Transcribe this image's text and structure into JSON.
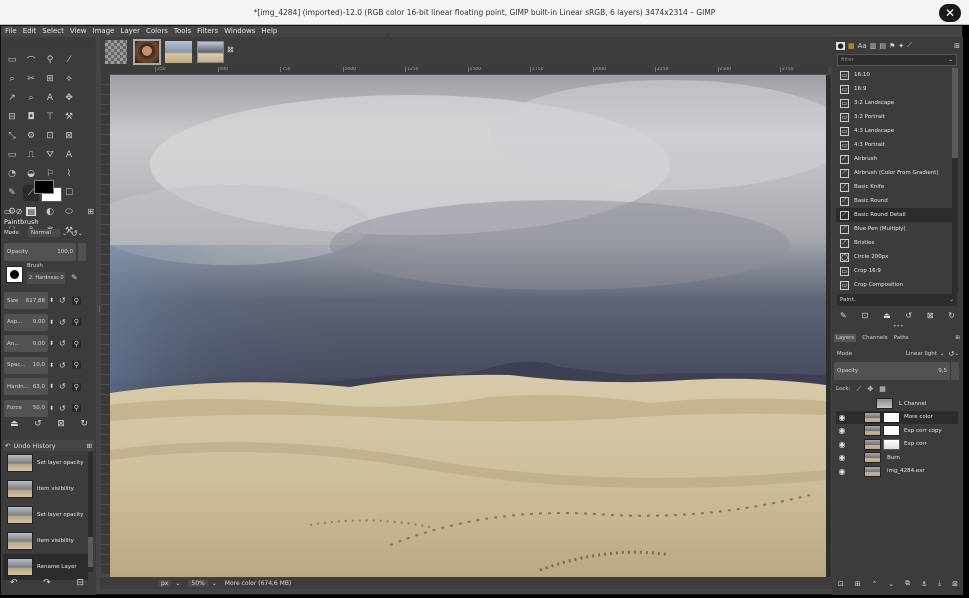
{
  "window": {
    "title": "*[img_4284] (imported)-12.0 (RGB color 16-bit linear floating point, GIMP built-in Linear sRGB, 6 layers) 3474x2314 – GIMP",
    "close_icon": "close-icon"
  },
  "menu": [
    "File",
    "Edit",
    "Select",
    "View",
    "Image",
    "Layer",
    "Colors",
    "Tools",
    "Filters",
    "Windows",
    "Help"
  ],
  "image_tabs": {
    "close_glyph": "⊠"
  },
  "ruler": {
    "ticks": [
      "250",
      "500",
      "750",
      "1000",
      "1250",
      "1500",
      "1750",
      "2000",
      "2250",
      "2500",
      "2750"
    ]
  },
  "toolbox": {
    "tools": [
      "▭",
      "⌒",
      "⚲",
      "⁄",
      "⌕",
      "✂",
      "⊞",
      "⟡",
      "↗",
      "⌕",
      "A",
      "✥",
      "⊟",
      "◘",
      "⊤",
      "⚒",
      "⤡",
      "⚙",
      "⊡",
      "⊠",
      "▭",
      "⎍",
      "⛛",
      "A",
      "◔",
      "◒",
      "⚐",
      "⌇",
      "✎",
      "⟋",
      "◌",
      "☐",
      "⚙",
      "✿",
      "◐",
      "⬭",
      "⛶",
      "⚘",
      "❋",
      "⚒",
      "⚗",
      "⊕",
      "◐"
    ],
    "fg_color": "#000000",
    "bg_color": "#ffffff"
  },
  "tool_options": {
    "title": "Paintbrush",
    "mode_label": "Mode",
    "mode_value": "Normal",
    "opacity_label": "Opacity",
    "opacity_value": "100,0",
    "brush_label": "Brush",
    "brush_name": "2. Hardness 0",
    "size_label": "Size",
    "size_value": "617,88",
    "aspect_label": "Asp...",
    "aspect_value": "0,00",
    "angle_label": "An...",
    "angle_value": "0,00",
    "spacing_label": "Spac...",
    "spacing_value": "10,0",
    "hardness_label": "Hardn...",
    "hardness_value": "63,0",
    "force_label": "Force",
    "force_value": "50,0"
  },
  "undo_history": {
    "title": "Undo History",
    "items": [
      "Set layer opacity",
      "Item visibility",
      "Set layer opacity",
      "Item visibility",
      "Rename Layer"
    ]
  },
  "statusbar": {
    "unit": "px",
    "zoom": "50%",
    "message": "More color (674,6 MB)"
  },
  "brushes": {
    "filter_placeholder": "filter",
    "items": [
      "16:10",
      "16:9",
      "3:2 Landscape",
      "3:2 Portrait",
      "4:3 Landscape",
      "4:3 Portrait",
      "Airbrush",
      "Airbrush (Color From Gradient)",
      "Basic Knife",
      "Basic Round",
      "Basic Round Detail",
      "Blue Pen (Multiply)",
      "Bristles",
      "Circle 200px",
      "Crop 16:9",
      "Crop Composition"
    ],
    "selected_index": 10,
    "category": "Paint."
  },
  "layers": {
    "tabs": [
      "Layers",
      "Channels",
      "Paths"
    ],
    "mode_label": "Mode",
    "mode_value": "Linear light",
    "opacity_label": "Opacity",
    "opacity_value": "9,5",
    "lock_label": "Lock:",
    "items": [
      {
        "name": "L Channel",
        "visible": false
      },
      {
        "name": "More color",
        "visible": true
      },
      {
        "name": "Exp corr copy",
        "visible": true
      },
      {
        "name": "Exp corr",
        "visible": true
      },
      {
        "name": "Burn",
        "visible": true
      },
      {
        "name": "img_4284.exr",
        "visible": true
      }
    ]
  }
}
